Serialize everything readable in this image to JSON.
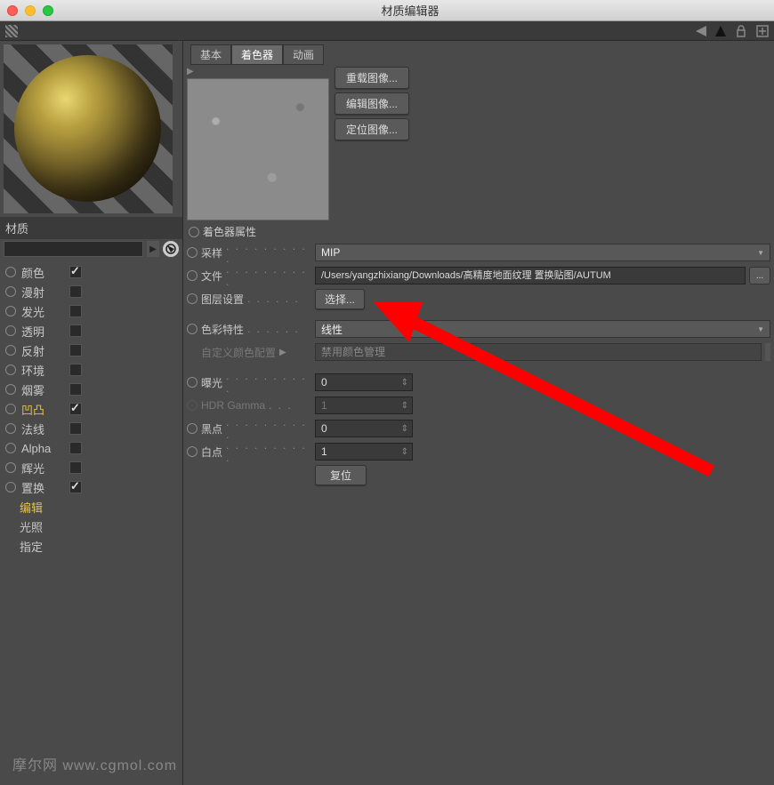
{
  "window": {
    "title": "材质编辑器"
  },
  "left": {
    "material_label": "材质",
    "channels": [
      {
        "key": "color",
        "label": "颜色",
        "checked": true
      },
      {
        "key": "diffuse",
        "label": "漫射",
        "checked": false
      },
      {
        "key": "luminance",
        "label": "发光",
        "checked": false
      },
      {
        "key": "transparency",
        "label": "透明",
        "checked": false
      },
      {
        "key": "reflection",
        "label": "反射",
        "checked": false
      },
      {
        "key": "environment",
        "label": "环境",
        "checked": false
      },
      {
        "key": "fog",
        "label": "烟雾",
        "checked": false
      },
      {
        "key": "bump",
        "label": "凹凸",
        "checked": true,
        "highlight": true
      },
      {
        "key": "normal",
        "label": "法线",
        "checked": false
      },
      {
        "key": "alpha",
        "label": "Alpha",
        "checked": false
      },
      {
        "key": "glow",
        "label": "辉光",
        "checked": false
      },
      {
        "key": "displacement",
        "label": "置换",
        "checked": true
      }
    ],
    "sub_items": [
      {
        "key": "edit",
        "label": "编辑",
        "highlight": true
      },
      {
        "key": "illumination",
        "label": "光照"
      },
      {
        "key": "assign",
        "label": "指定"
      }
    ]
  },
  "tabs": [
    {
      "key": "basic",
      "label": "基本"
    },
    {
      "key": "shader",
      "label": "着色器",
      "active": true
    },
    {
      "key": "animation",
      "label": "动画"
    }
  ],
  "texture_buttons": {
    "reload": "重载图像...",
    "edit": "编辑图像...",
    "locate": "定位图像..."
  },
  "shader_props": {
    "header": "着色器属性",
    "sampling_label": "采样",
    "sampling_value": "MIP",
    "file_label": "文件",
    "file_value": "/Users/yangzhixiang/Downloads/高精度地面纹理 置换贴图/AUTUM",
    "layerset_label": "图层设置",
    "layerset_btn": "选择...",
    "colorprofile_label": "色彩特性",
    "colorprofile_value": "线性",
    "customcolor_label": "自定义颜色配置",
    "customcolor_value": "禁用颜色管理",
    "exposure_label": "曝光",
    "exposure_value": "0",
    "hdrgamma_label": "HDR Gamma",
    "hdrgamma_value": "1",
    "blackpoint_label": "黑点",
    "blackpoint_value": "0",
    "whitepoint_label": "白点",
    "whitepoint_value": "1",
    "reset_btn": "复位"
  },
  "watermark": "摩尔网 www.cgmol.com"
}
